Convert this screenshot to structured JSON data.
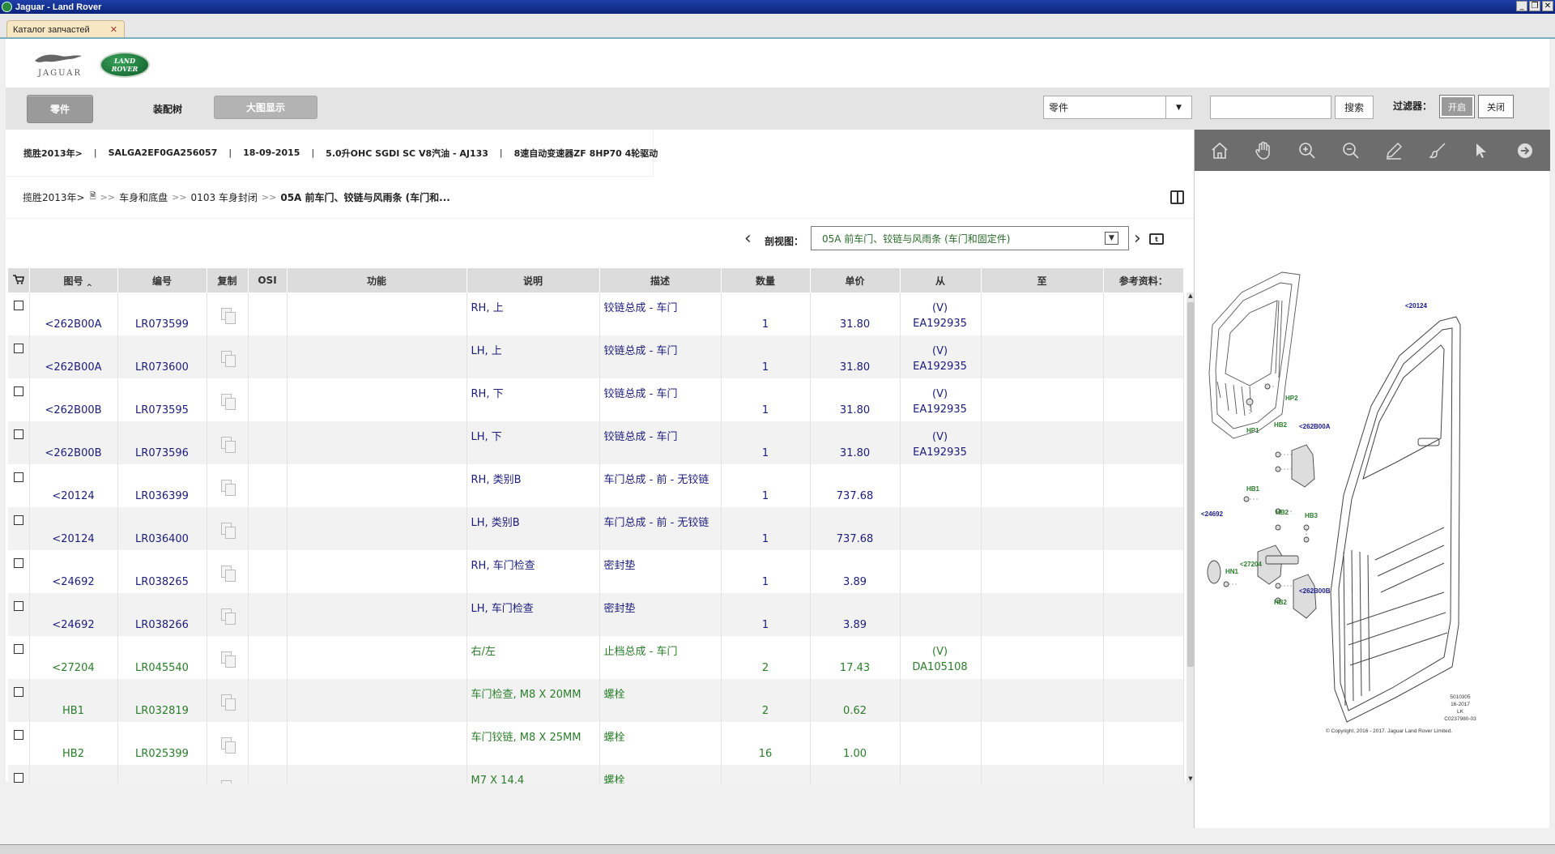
{
  "window": {
    "title": "Jaguar - Land Rover"
  },
  "tab": {
    "label": "Каталог запчастей"
  },
  "logos": {
    "jaguar": "JAGUAR",
    "landrover_line1": "LAND",
    "landrover_line2": "ROVER"
  },
  "toolbar": {
    "parts": "零件",
    "tree": "装配树",
    "bigview": "大图显示",
    "search_type": "零件",
    "search_value": "",
    "search_button": "搜索",
    "filter_label": "过滤器：",
    "filter_on": "开启",
    "filter_off": "关闭"
  },
  "vehicle": {
    "model": "揽胜2013年>",
    "vin": "SALGA2EF0GA256057",
    "date": "18-09-2015",
    "engine": "5.0升OHC SGDI SC V8汽油 - AJ133",
    "transmission": "8速自动变速器ZF 8HP70 4轮驱动"
  },
  "breadcrumb": {
    "root": "揽胜2013年>",
    "level1": "车身和底盘",
    "level2": "0103 车身封闭",
    "current": "05A 前车门、铰链与风雨条 (车门和..."
  },
  "view": {
    "label": "剖视图：",
    "selected": "05A 前车门、铰链与风雨条 (车门和固定件)"
  },
  "table": {
    "headers": [
      "图号",
      "编号",
      "复制",
      "OSI",
      "功能",
      "说明",
      "描述",
      "数量",
      "单价",
      "从",
      "至",
      "参考资料："
    ],
    "rows": [
      {
        "fig": "<262B00A",
        "part": "LR073599",
        "note": "RH, 上",
        "desc": "铰链总成 - 车门",
        "qty": "1",
        "price": "31.80",
        "from": "(V) EA192935",
        "to": "",
        "green": false
      },
      {
        "fig": "<262B00A",
        "part": "LR073600",
        "note": "LH, 上",
        "desc": "铰链总成 - 车门",
        "qty": "1",
        "price": "31.80",
        "from": "(V) EA192935",
        "to": "",
        "green": false
      },
      {
        "fig": "<262B00B",
        "part": "LR073595",
        "note": "RH, 下",
        "desc": "铰链总成 - 车门",
        "qty": "1",
        "price": "31.80",
        "from": "(V) EA192935",
        "to": "",
        "green": false
      },
      {
        "fig": "<262B00B",
        "part": "LR073596",
        "note": "LH, 下",
        "desc": "铰链总成 - 车门",
        "qty": "1",
        "price": "31.80",
        "from": "(V) EA192935",
        "to": "",
        "green": false
      },
      {
        "fig": "<20124",
        "part": "LR036399",
        "note": "RH, 类别B",
        "desc": "车门总成 - 前 - 无铰链",
        "qty": "1",
        "price": "737.68",
        "from": "",
        "to": "",
        "green": false
      },
      {
        "fig": "<20124",
        "part": "LR036400",
        "note": "LH, 类别B",
        "desc": "车门总成 - 前 - 无铰链",
        "qty": "1",
        "price": "737.68",
        "from": "",
        "to": "",
        "green": false
      },
      {
        "fig": "<24692",
        "part": "LR038265",
        "note": "RH, 车门检查",
        "desc": "密封垫",
        "qty": "1",
        "price": "3.89",
        "from": "",
        "to": "",
        "green": false
      },
      {
        "fig": "<24692",
        "part": "LR038266",
        "note": "LH, 车门检查",
        "desc": "密封垫",
        "qty": "1",
        "price": "3.89",
        "from": "",
        "to": "",
        "green": false
      },
      {
        "fig": "<27204",
        "part": "LR045540",
        "note": "右/左",
        "desc": "止档总成 - 车门",
        "qty": "2",
        "price": "17.43",
        "from": "(V) DA105108",
        "to": "",
        "green": true
      },
      {
        "fig": "HB1",
        "part": "LR032819",
        "note": "车门检查, M8 X 20MM",
        "desc": "螺栓",
        "qty": "2",
        "price": "0.62",
        "from": "",
        "to": "",
        "green": true
      },
      {
        "fig": "HB2",
        "part": "LR025399",
        "note": "车门铰链, M8 X 25MM",
        "desc": "螺栓",
        "qty": "16",
        "price": "1.00",
        "from": "",
        "to": "",
        "green": true
      },
      {
        "fig": "",
        "part": "",
        "note": "M7 X 14.4",
        "desc": "螺栓",
        "qty": "",
        "price": "",
        "from": "",
        "to": "",
        "green": true
      }
    ]
  },
  "diagram": {
    "labels": [
      "<20124",
      "HP2",
      "HP1",
      "HB2",
      "<262B00A",
      "HB1",
      "HB2",
      "HB3",
      "<24692",
      "<27204",
      "HN1",
      "HB2",
      "<262B00B"
    ],
    "stamp": [
      "5010305",
      "16-2017",
      "LK",
      "C0237980-03"
    ],
    "copyright": "© Copyright, 2016 - 2017. Jaguar Land Rover Limited."
  },
  "icons": [
    "home-icon",
    "hand-icon",
    "zoom-in-icon",
    "zoom-out-icon",
    "pencil-icon",
    "brush-icon",
    "pointer-icon",
    "arrow-right-icon"
  ]
}
